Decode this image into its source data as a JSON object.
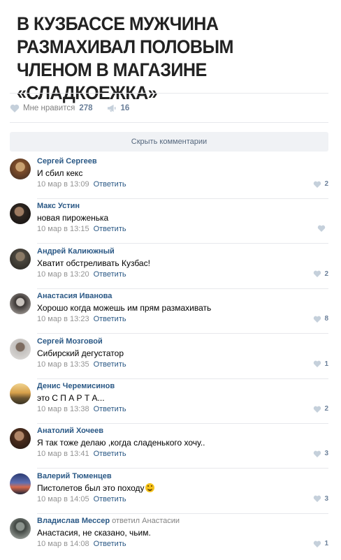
{
  "post": {
    "headline": "В КУЗБАССЕ МУЖЧИНА РАЗМАХИВАЛ ПОЛОВЫМ ЧЛЕНОМ В МАГАЗИНЕ «СЛАДКОЕЖКА»",
    "likes_label": "Мне нравится",
    "likes_count": "278",
    "reposts_count": "16"
  },
  "hide_comments_label": "Скрыть комментарии",
  "reply_label": "Ответить",
  "colors": {
    "link": "#2a5885",
    "muted": "#939393",
    "icon": "#c5d0db",
    "button_bg": "#f0f2f5"
  },
  "comments": [
    {
      "author": "Сергей Сергеев",
      "text": "И сбил кекс",
      "date": "10 мар в 13:09",
      "likes": "2"
    },
    {
      "author": "Макс Устин",
      "text": "новая пироженька",
      "date": "10 мар в 13:15",
      "likes": ""
    },
    {
      "author": "Андрей Калиюжный",
      "text": "Хватит обстреливать Кузбас!",
      "date": "10 мар в 13:20",
      "likes": "2"
    },
    {
      "author": "Анастасия Иванова",
      "text": "Хорошо когда можешь им прям размахивать",
      "date": "10 мар в 13:23",
      "likes": "8"
    },
    {
      "author": "Сергей Мозговой",
      "text": "Сибирский дегустатор",
      "date": "10 мар в 13:35",
      "likes": "1"
    },
    {
      "author": "Денис Черемисинов",
      "text": "это С П А Р Т А...",
      "date": "10 мар в 13:38",
      "likes": "2"
    },
    {
      "author": "Анатолий Хочеев",
      "text": "Я так тоже делаю ,когда сладенького хочу..",
      "date": "10 мар в 13:41",
      "likes": "3"
    },
    {
      "author": "Валерий Тюменцев",
      "text": "Пистолетов был это походу",
      "date": "10 мар в 14:05",
      "likes": "3"
    },
    {
      "author": "Владислав Мессер",
      "reply_to_word": "ответил",
      "reply_to_name": "Анастасии",
      "text": "Анастасия, не сказано, чьим.",
      "date": "10 мар в 14:08",
      "likes": "1"
    }
  ]
}
